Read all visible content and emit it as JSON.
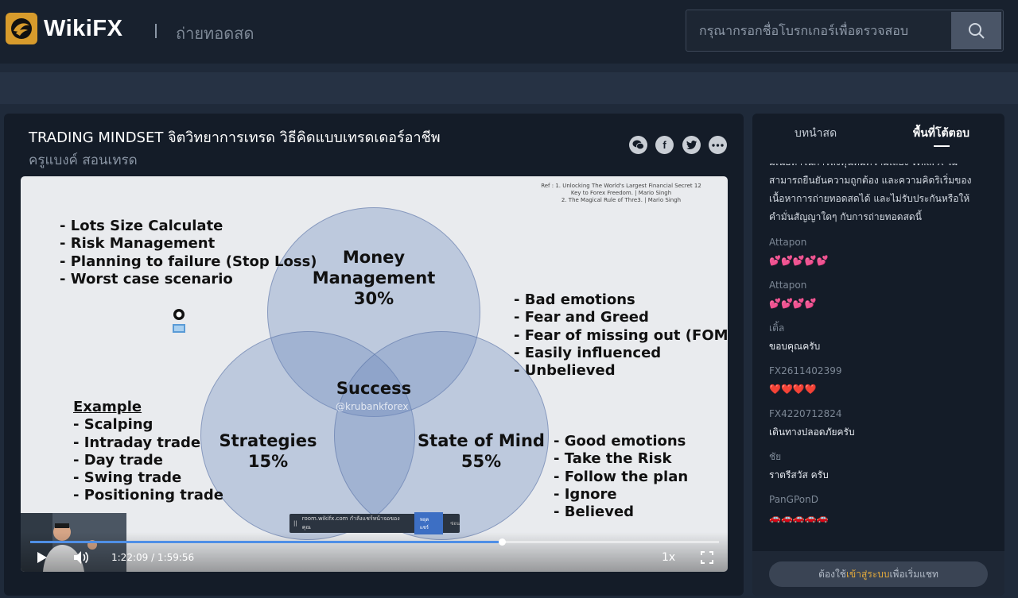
{
  "header": {
    "logo_text": "WikiFX",
    "page_name": "ถ่ายทอดสด",
    "search_placeholder": "กรุณากรอกชื่อโบรกเกอร์เพื่อตรวจสอบ"
  },
  "stream": {
    "title": "TRADING MINDSET จิตวิทยาการเทรด วิธีคิดแบบเทรดเดอร์อาชีพ",
    "host": "ครูแบงค์ สอนเทรด",
    "share_icons": [
      "wechat-icon",
      "facebook-icon",
      "twitter-icon",
      "more-icon"
    ]
  },
  "slide": {
    "ref_lines": [
      "Ref : 1. Unlocking The World's Largest Financial Secret 12",
      "Key to Forex Freedom. | Mario Singh",
      "2. The Magical Rule of Thre3. | Mario Singh"
    ],
    "money_list": [
      "- Lots Size Calculate",
      "- Risk Management",
      "- Planning to failure (Stop Loss)",
      "- Worst case scenario"
    ],
    "emotion_list": [
      "- Bad emotions",
      "- Fear and Greed",
      "- Fear of missing out (FOMO)",
      "- Easily influenced",
      "- Unbelieved"
    ],
    "example_title": "Example",
    "example_list": [
      "- Scalping",
      "- Intraday trade",
      "- Day trade",
      "- Swing trade",
      "- Positioning trade"
    ],
    "mind_list": [
      "- Good emotions",
      "- Take the Risk",
      "- Follow the plan",
      "- Ignore",
      "- Believed"
    ],
    "circle_money": [
      "Money",
      "Management",
      "30%"
    ],
    "circle_strategies": [
      "Strategies",
      "15%"
    ],
    "circle_mind": [
      "State of Mind",
      "55%"
    ],
    "center_label": "Success",
    "watermark": "@krubankforex",
    "banner_text": "room.wikifx.com กำลังแชร์หน้าจอของคุณ",
    "banner_stop": "หยุดแชร์",
    "banner_hide": "ซ่อน"
  },
  "player": {
    "time": "1:22:09 / 1:59:56",
    "speed": "1x",
    "progress": 0.685,
    "colors": {
      "accent": "#4f8fe6"
    }
  },
  "sidebar": {
    "tabs": [
      "บทนำสด",
      "พื้นที่โต้ตอบ"
    ],
    "active_tab": 1,
    "notice_lines": [
      "มีเนื้อหาในการลงทุนที่มีความเสี่ยง WikiFX ไม่",
      "สามารถยืนยันความถูกต้อง และความคิดริเริ่มของ",
      "เนื้อหาการถ่ายทอดสดได้ และไม่รับประกันหรือให้",
      "คำมั่นสัญญาใดๆ กับการถ่ายทอดสดนี้"
    ],
    "messages": [
      {
        "name": "Attapon",
        "text": "💕💕💕💕💕"
      },
      {
        "name": "Attapon",
        "text": "💕💕💕💕"
      },
      {
        "name": "เติ้ล",
        "text": "ขอบคุณครับ"
      },
      {
        "name": "FX2611402399",
        "text": "❤️❤️❤️❤️"
      },
      {
        "name": "FX4220712824",
        "text": "เดินทางปลอดภัยครับ"
      },
      {
        "name": "ชัย",
        "text": "ราตรีสวัส ครับ"
      },
      {
        "name": "PanGPonD",
        "text": "🚗🚗🚗🚗🚗"
      }
    ],
    "login_prefix": "ต้องใช้",
    "login_link": "เข้าสู่ระบบ",
    "login_suffix": "เพื่อเริ่มแชท"
  }
}
